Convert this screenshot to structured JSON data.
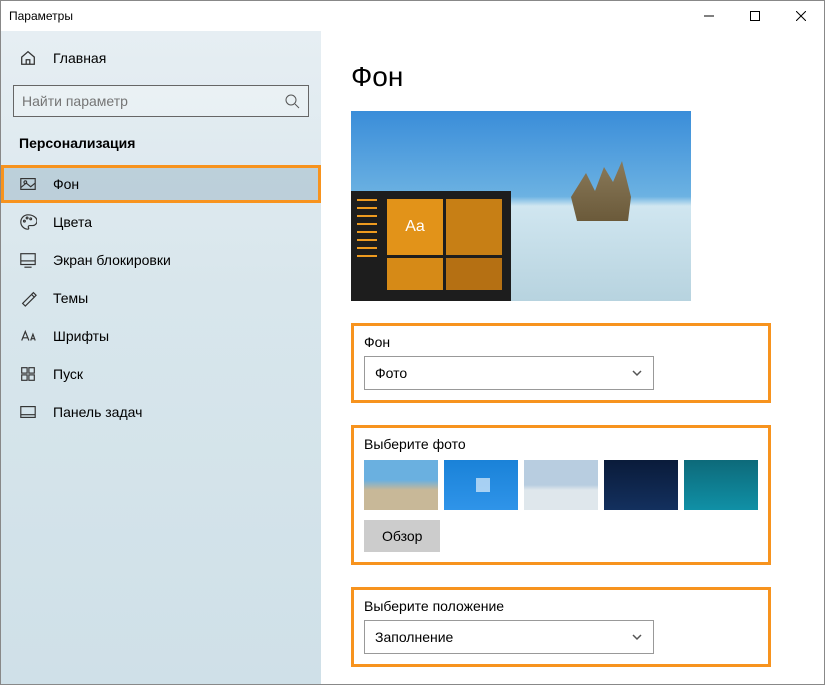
{
  "window": {
    "title": "Параметры"
  },
  "sidebar": {
    "home": "Главная",
    "search_placeholder": "Найти параметр",
    "category": "Персонализация",
    "items": [
      {
        "label": "Фон",
        "selected": true
      },
      {
        "label": "Цвета"
      },
      {
        "label": "Экран блокировки"
      },
      {
        "label": "Темы"
      },
      {
        "label": "Шрифты"
      },
      {
        "label": "Пуск"
      },
      {
        "label": "Панель задач"
      }
    ]
  },
  "page": {
    "title": "Фон",
    "background_label": "Фон",
    "background_value": "Фото",
    "choose_photo_label": "Выберите фото",
    "browse": "Обзор",
    "fit_label": "Выберите положение",
    "fit_value": "Заполнение",
    "preview_aa": "Aa"
  }
}
